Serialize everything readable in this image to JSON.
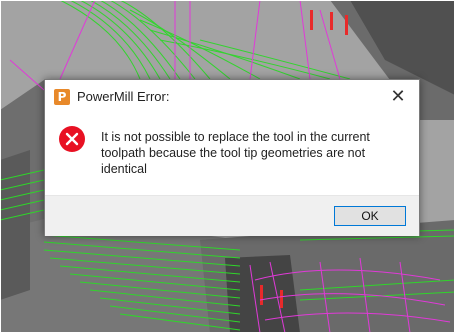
{
  "dialog": {
    "title": "PowerMill Error:",
    "close_glyph": "✕",
    "app_icon": "powermill-logo-icon",
    "error_icon": "error-x-icon",
    "message": "It is not possible to replace the tool in the current toolpath because the tool tip geometries are not identical",
    "ok_label": "OK"
  },
  "colors": {
    "toolpath_green": "#2fd62a",
    "toolpath_magenta": "#e03ad8",
    "error_red": "#e81123",
    "button_border": "#0078d7"
  }
}
